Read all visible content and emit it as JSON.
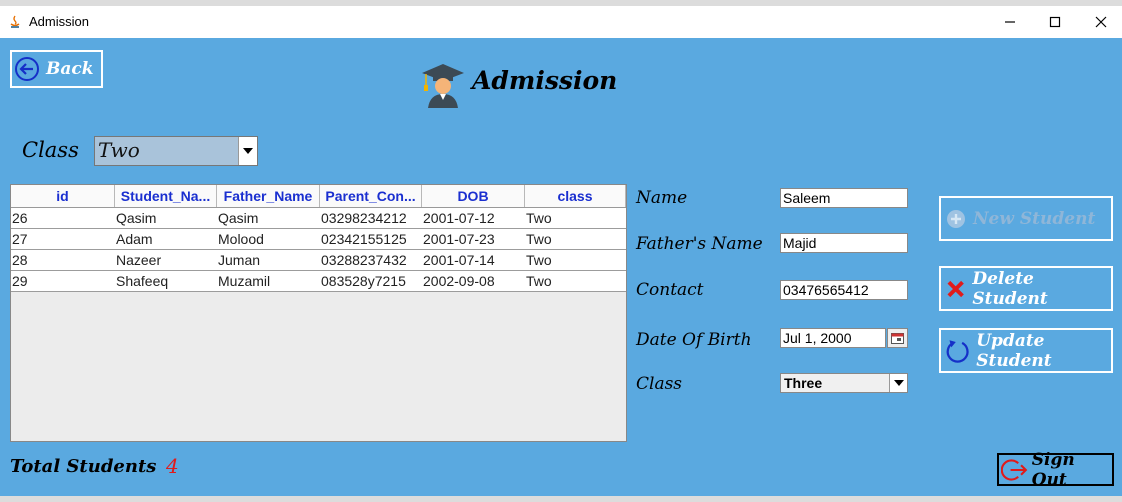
{
  "window": {
    "title": "Admission"
  },
  "header": {
    "back_label": "Back",
    "title": "Admission"
  },
  "class_filter": {
    "label": "Class",
    "selected": "Two"
  },
  "table": {
    "columns": [
      "id",
      "Student_Na...",
      "Father_Name",
      "Parent_Con...",
      "DOB",
      "class"
    ],
    "rows": [
      [
        "26",
        "Qasim",
        "Qasim",
        "03298234212",
        "2001-07-12",
        "Two"
      ],
      [
        "27",
        "Adam",
        "Molood",
        "02342155125",
        "2001-07-23",
        "Two"
      ],
      [
        "28",
        "Nazeer",
        "Juman",
        "03288237432",
        "2001-07-14",
        "Two"
      ],
      [
        "29",
        "Shafeeq",
        "Muzamil",
        "083528y7215",
        "2002-09-08",
        "Two"
      ]
    ]
  },
  "form": {
    "name_label": "Name",
    "name_value": "Saleem",
    "father_label": "Father's Name",
    "father_value": "Majid",
    "contact_label": "Contact",
    "contact_value": "03476565412",
    "dob_label": "Date Of Birth",
    "dob_value": "Jul 1, 2000",
    "class_label": "Class",
    "class_value": "Three"
  },
  "actions": {
    "new_label": "New Student",
    "delete_label": "Delete Student",
    "update_label": "Update Student",
    "signout_label": "Sign Out"
  },
  "footer": {
    "total_label": "Total Students",
    "total_value": "4"
  },
  "colors": {
    "background": "#5aa9e0",
    "header_text": "#1a2fd0",
    "count_red": "#e01b1b",
    "delete_red": "#e01b1b"
  },
  "icons": [
    "java-app-icon",
    "minimize-icon",
    "maximize-icon",
    "close-icon",
    "back-arrow-icon",
    "graduate-icon",
    "chevron-down-icon",
    "calendar-icon",
    "plus-circle-icon",
    "x-mark-icon",
    "refresh-icon",
    "logout-icon"
  ]
}
